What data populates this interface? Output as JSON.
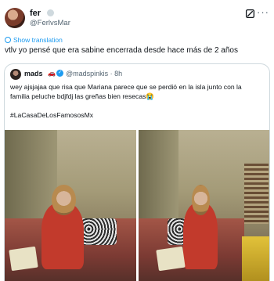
{
  "post": {
    "name": "fer",
    "handle": "@FerlvsMar",
    "translate_label": "Show translation",
    "text": "vtlv yo pensé que era sabine encerrada desde hace más de 2 años",
    "more_icon": "more-dots-icon",
    "grok_icon": "grok-icon"
  },
  "quote": {
    "name": "mads",
    "name_emoji": "🚗",
    "handle_time": "@madspinkis · 8h",
    "line1": "wey ajsjajaa que risa que Mariana parece que se perdió en la isla junto con la",
    "line2": "familia peluche bdjfdj las greñas bien resecas😭",
    "hashtag": "#LaCasaDeLosFamososMx"
  },
  "colors": {
    "accent": "#1d9bf0",
    "text": "#0f1419",
    "secondary": "#536471",
    "border": "#cfd9de"
  }
}
